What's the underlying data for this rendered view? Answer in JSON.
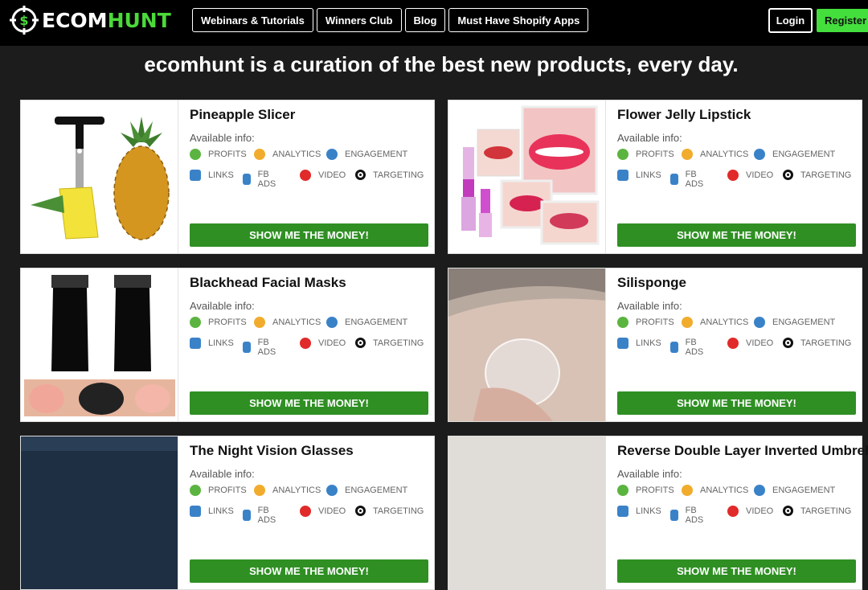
{
  "header": {
    "logo_word_a": "ECOM",
    "logo_word_b": "HUNT",
    "nav": [
      "Webinars & Tutorials",
      "Winners Club",
      "Blog",
      "Must Have Shopify Apps"
    ],
    "login": "Login",
    "register": "Register"
  },
  "tagline": "ecomhunt is a curation of the best new products, every day.",
  "common": {
    "available_label": "Available info:",
    "features_row1": [
      "PROFITS",
      "ANALYTICS",
      "ENGAGEMENT"
    ],
    "features_row2": [
      "LINKS",
      "FB ADS",
      "VIDEO",
      "TARGETING"
    ],
    "button": "SHOW ME THE MONEY!"
  },
  "products": [
    {
      "title": "Pineapple Slicer",
      "image": "pineapple-slicer-photo"
    },
    {
      "title": "Flower Jelly Lipstick",
      "image": "lipstick-photo"
    },
    {
      "title": "Blackhead Facial Masks",
      "image": "facial-mask-photo"
    },
    {
      "title": "Silisponge",
      "image": "silisponge-photo"
    },
    {
      "title": "The Night Vision Glasses",
      "image": "night-vision-photo"
    },
    {
      "title": "Reverse Double Layer Inverted Umbrella",
      "image": "umbrella-photo"
    }
  ],
  "colors": {
    "accent_green": "#44de3d",
    "button_green": "#2f8f23",
    "background": "#1c1c1c"
  }
}
